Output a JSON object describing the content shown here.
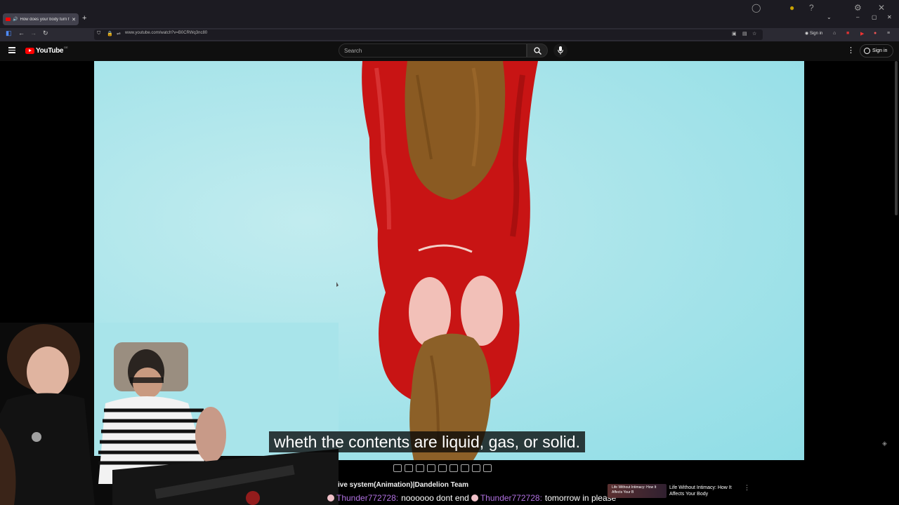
{
  "browser": {
    "tab_title": "How does your body turn f",
    "url": "www.youtube.com/watch?v=B0CRWq3nc80",
    "signin_small": "Sign in",
    "new_tab": "+",
    "min": "–",
    "max": "▢",
    "close": "✕"
  },
  "youtube": {
    "logo_text": "YouTube",
    "logo_region": "DE",
    "search_placeholder": "Search",
    "signin": "Sign in"
  },
  "video": {
    "caption": "wheth    the contents are liquid, gas, or solid.",
    "title_fragment": "ive system(Animation)|Dandelion Team"
  },
  "chat": {
    "user1": "Thunder772728:",
    "msg1": "noooooo dont end",
    "user2": "Thunder772728:",
    "msg2": "tomorrow in please"
  },
  "recommendation": {
    "thumb_text": "Life Without Intimacy: How It Affects Your B",
    "title": "Life Without Intimacy: How It Affects Your Body"
  },
  "icons": [
    "speaker-icon",
    "close-icon",
    "back-icon",
    "forward-icon",
    "reload-icon",
    "shield-icon",
    "lock-icon",
    "search-icon",
    "mic-icon",
    "kebab-icon",
    "account-icon"
  ]
}
